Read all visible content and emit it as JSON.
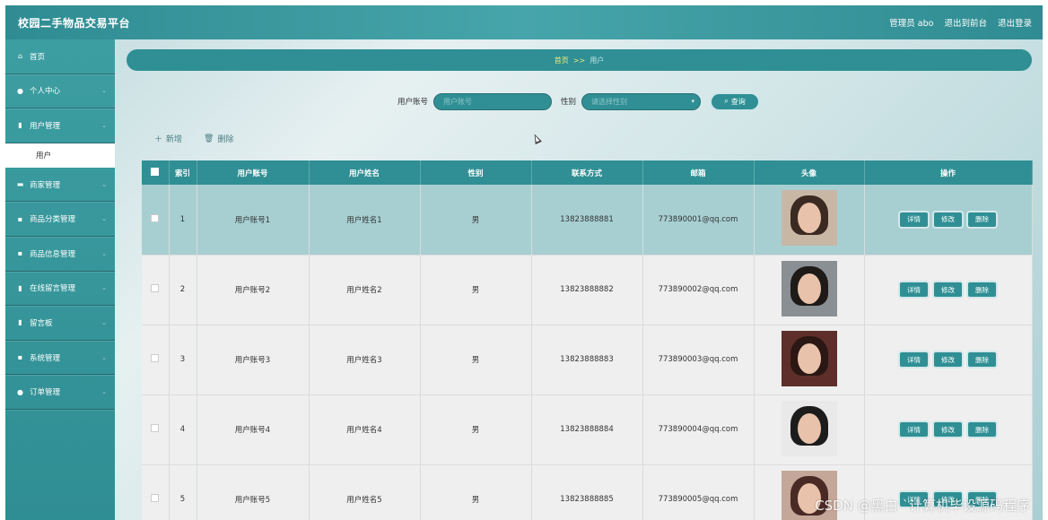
{
  "header": {
    "brand": "校园二手物品交易平台",
    "user": "管理员 abo",
    "to_front": "退出到前台",
    "logout": "退出登录"
  },
  "sidebar": {
    "items": [
      {
        "label": "首页",
        "icon": "home-icon",
        "glyph": "⌂"
      },
      {
        "label": "个人中心",
        "icon": "person-icon",
        "glyph": "●"
      },
      {
        "label": "用户管理",
        "icon": "doc-icon",
        "glyph": "▮"
      },
      {
        "label": "商家管理",
        "icon": "card-icon",
        "glyph": "▬"
      },
      {
        "label": "商品分类管理",
        "icon": "grid-icon",
        "glyph": "▪"
      },
      {
        "label": "商品信息管理",
        "icon": "grid-icon",
        "glyph": "▪"
      },
      {
        "label": "在线留言管理",
        "icon": "doc-icon",
        "glyph": "▮"
      },
      {
        "label": "留言板",
        "icon": "doc-icon",
        "glyph": "▮"
      },
      {
        "label": "系统管理",
        "icon": "grid-icon",
        "glyph": "▪"
      },
      {
        "label": "订单管理",
        "icon": "person-icon",
        "glyph": "●"
      }
    ],
    "sub_item": "用户"
  },
  "breadcrumb": {
    "home": "首页",
    "sep": ">>",
    "current": "用户"
  },
  "search": {
    "account_label": "用户账号",
    "account_placeholder": "用户账号",
    "gender_label": "性别",
    "gender_placeholder": "请选择性别",
    "query_label": "查询"
  },
  "toolbar": {
    "add": "新增",
    "delete": "删除"
  },
  "table": {
    "headers": [
      "",
      "索引",
      "用户账号",
      "用户姓名",
      "性别",
      "联系方式",
      "邮箱",
      "头像",
      "操作"
    ],
    "rows": [
      {
        "index": "1",
        "account": "用户账号1",
        "name": "用户姓名1",
        "gender": "男",
        "phone": "13823888881",
        "email": "773890001@qq.com"
      },
      {
        "index": "2",
        "account": "用户账号2",
        "name": "用户姓名2",
        "gender": "男",
        "phone": "13823888882",
        "email": "773890002@qq.com"
      },
      {
        "index": "3",
        "account": "用户账号3",
        "name": "用户姓名3",
        "gender": "男",
        "phone": "13823888883",
        "email": "773890003@qq.com"
      },
      {
        "index": "4",
        "account": "用户账号4",
        "name": "用户姓名4",
        "gender": "男",
        "phone": "13823888884",
        "email": "773890004@qq.com"
      },
      {
        "index": "5",
        "account": "用户账号5",
        "name": "用户姓名5",
        "gender": "男",
        "phone": "13823888885",
        "email": "773890005@qq.com"
      }
    ],
    "ops": {
      "detail": "详情",
      "edit": "修改",
      "delete": "删除"
    }
  },
  "watermark": "CSDN @黑白 `计算机毕设源码程序"
}
